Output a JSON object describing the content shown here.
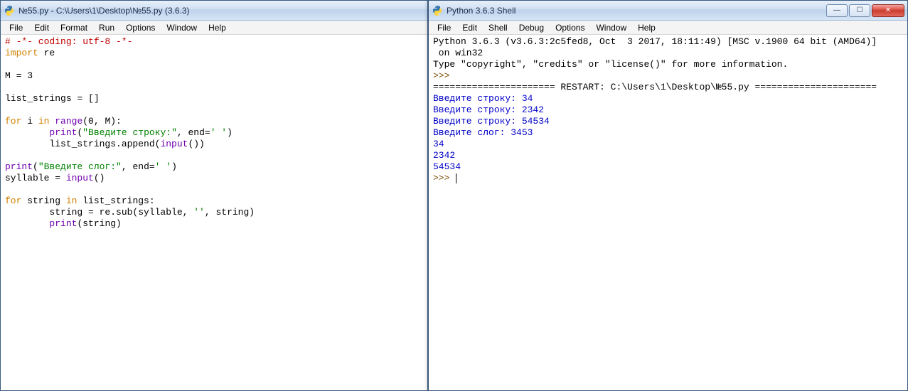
{
  "editor": {
    "title": "№55.py - C:\\Users\\1\\Desktop\\№55.py (3.6.3)",
    "menu": [
      "File",
      "Edit",
      "Format",
      "Run",
      "Options",
      "Window",
      "Help"
    ],
    "code": {
      "l1": "# -*- coding: utf-8 -*-",
      "l2a": "import",
      "l2b": " re",
      "l3": "",
      "l4": "M = 3",
      "l5": "",
      "l6": "list_strings = []",
      "l7": "",
      "l8a": "for",
      "l8b": " i ",
      "l8c": "in",
      "l8d": " ",
      "l8e": "range",
      "l8f": "(0, M):",
      "l9a": "        ",
      "l9b": "print",
      "l9c": "(",
      "l9d": "\"Введите строку:\"",
      "l9e": ", end=",
      "l9f": "' '",
      "l9g": ")",
      "l10a": "        list_strings.append(",
      "l10b": "input",
      "l10c": "())",
      "l11": "",
      "l12a": "print",
      "l12b": "(",
      "l12c": "\"Введите слог:\"",
      "l12d": ", end=",
      "l12e": "' '",
      "l12f": ")",
      "l13a": "syllable = ",
      "l13b": "input",
      "l13c": "()",
      "l14": "",
      "l15a": "for",
      "l15b": " string ",
      "l15c": "in",
      "l15d": " list_strings:",
      "l16a": "        string = re.sub(syllable, ",
      "l16b": "''",
      "l16c": ", string)",
      "l17a": "        ",
      "l17b": "print",
      "l17c": "(string)"
    }
  },
  "shell": {
    "title": "Python 3.6.3 Shell",
    "menu": [
      "File",
      "Edit",
      "Shell",
      "Debug",
      "Options",
      "Window",
      "Help"
    ],
    "out": {
      "l1": "Python 3.6.3 (v3.6.3:2c5fed8, Oct  3 2017, 18:11:49) [MSC v.1900 64 bit (AMD64)]",
      "l1b": " on win32",
      "l2": "Type \"copyright\", \"credits\" or \"license()\" for more information.",
      "p1": ">>> ",
      "l3": "====================== RESTART: C:\\Users\\1\\Desktop\\№55.py ======================",
      "l4": "Введите строку: 34",
      "l5": "Введите строку: 2342",
      "l6": "Введите строку: 54534",
      "l7": "Введите слог: 3453",
      "l8": "34",
      "l9": "2342",
      "l10": "54534",
      "p2": ">>> "
    },
    "controls": {
      "min": "—",
      "max": "☐",
      "close": "✕"
    }
  }
}
